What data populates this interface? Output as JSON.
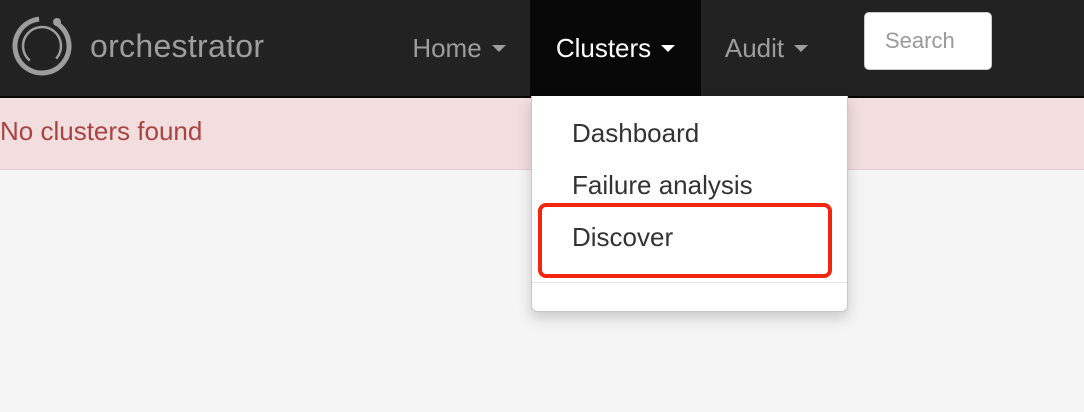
{
  "navbar": {
    "brand": "orchestrator",
    "logo_icon": "orchestrator-ring-logo-icon",
    "items": [
      {
        "label": "Home",
        "has_dropdown": true,
        "active": false
      },
      {
        "label": "Clusters",
        "has_dropdown": true,
        "active": true
      },
      {
        "label": "Audit",
        "has_dropdown": true,
        "active": false
      }
    ],
    "search": {
      "placeholder": "Search",
      "value": ""
    }
  },
  "alert": {
    "text": "No clusters found"
  },
  "clusters_menu": {
    "items": [
      {
        "label": "Dashboard"
      },
      {
        "label": "Failure analysis"
      },
      {
        "label": "Discover",
        "highlighted": true
      }
    ]
  },
  "colors": {
    "navbar_bg": "#222222",
    "navbar_active_bg": "#080808",
    "nav_text": "#9d9d9d",
    "alert_bg": "#f2dede",
    "alert_text": "#a94442",
    "highlight": "#f2250f"
  }
}
